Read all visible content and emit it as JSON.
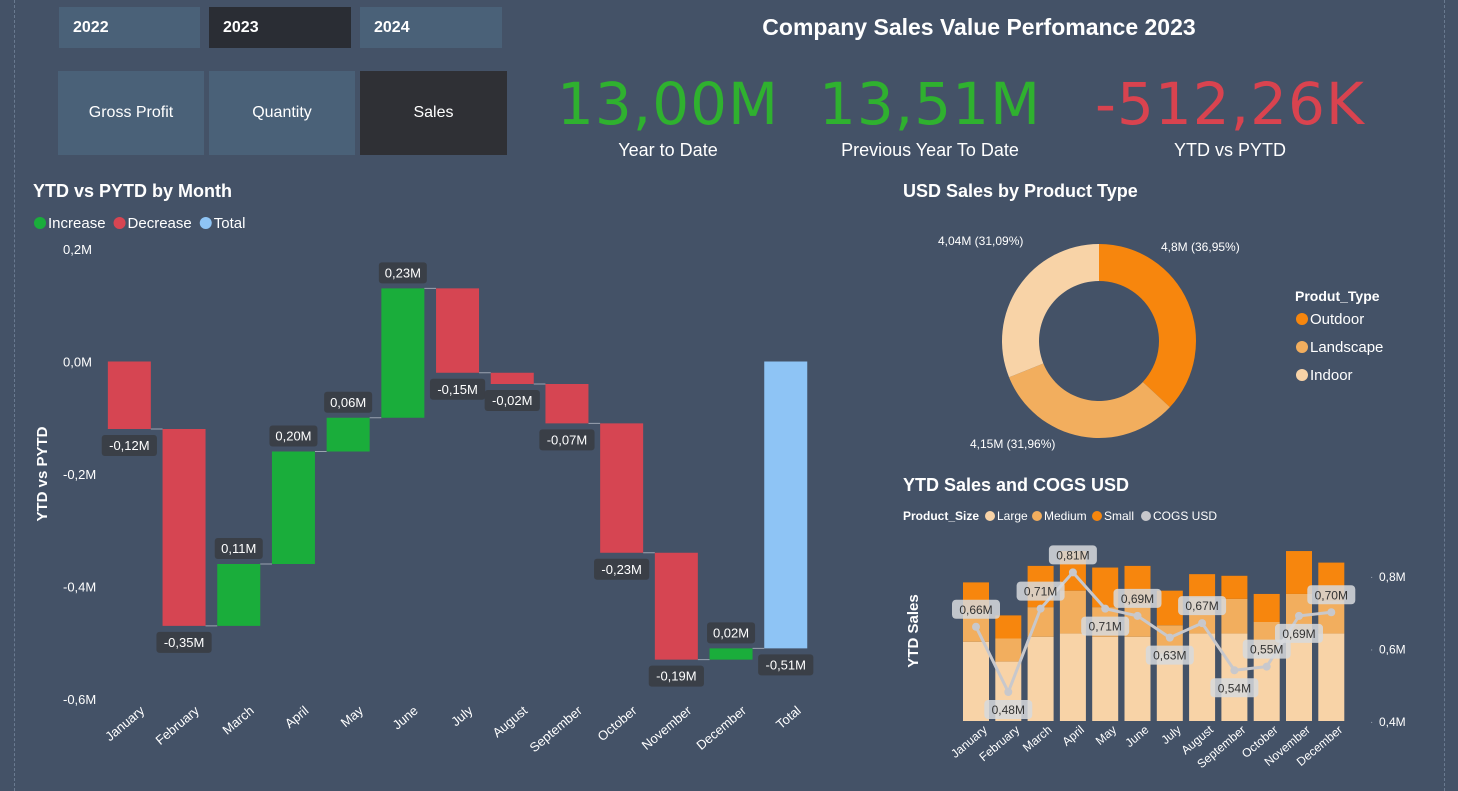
{
  "year_slicer": {
    "items": [
      "2022",
      "2023",
      "2024"
    ],
    "selected": 1
  },
  "measure_slicer": {
    "items": [
      "Gross Profit",
      "Quantity",
      "Sales"
    ],
    "selected": 2
  },
  "page_title": "Company Sales Value Perfomance 2023",
  "kpis": [
    {
      "value": "13,00M",
      "label": "Year to Date",
      "color": "#2fb12f"
    },
    {
      "value": "13,51M",
      "label": "Previous Year To Date",
      "color": "#2fb12f"
    },
    {
      "value": "-512,26K",
      "label": "YTD vs PYTD",
      "color": "#d9434f"
    }
  ],
  "colors": {
    "increase": "#1aad3b",
    "decrease": "#d64552",
    "total": "#8ec4f5",
    "outdoor": "#f7860d",
    "landscape": "#f2ae5e",
    "indoor": "#f8d3a7",
    "cogs": "#c8c8cc",
    "label_bg": "#3a3f47"
  },
  "chart_data": [
    {
      "type": "waterfall",
      "title": "YTD vs PYTD by Month",
      "legend": [
        "Increase",
        "Decrease",
        "Total"
      ],
      "legend_position": "top-left",
      "ylabel": "YTD vs PYTD",
      "ylim": [
        -0.6,
        0.2
      ],
      "yticks": [
        0.2,
        0.0,
        -0.2,
        -0.4,
        -0.6
      ],
      "ytick_labels": [
        "0,2M",
        "0,0M",
        "-0,2M",
        "-0,4M",
        "-0,6M"
      ],
      "categories": [
        "January",
        "February",
        "March",
        "April",
        "May",
        "June",
        "July",
        "August",
        "September",
        "October",
        "November",
        "December",
        "Total"
      ],
      "values": [
        -0.12,
        -0.35,
        0.11,
        0.2,
        0.06,
        0.23,
        -0.15,
        -0.02,
        -0.07,
        -0.23,
        -0.19,
        0.02,
        -0.51
      ],
      "labels": [
        "-0,12M",
        "-0,35M",
        "0,11M",
        "0,20M",
        "0,06M",
        "0,23M",
        "-0,15M",
        "-0,02M",
        "-0,07M",
        "-0,23M",
        "-0,19M",
        "0,02M",
        "-0,51M"
      ]
    },
    {
      "type": "pie",
      "donut": true,
      "title": "USD Sales by Product Type",
      "legend_title": "Produt_Type",
      "legend_position": "right",
      "slices": [
        {
          "name": "Outdoor",
          "value": 4.8,
          "percent": 36.95,
          "label": "4,8M (36,95%)"
        },
        {
          "name": "Landscape",
          "value": 4.15,
          "percent": 31.96,
          "label": "4,15M (31,96%)"
        },
        {
          "name": "Indoor",
          "value": 4.04,
          "percent": 31.09,
          "label": "4,04M (31,09%)"
        }
      ]
    },
    {
      "type": "bar",
      "stacked": true,
      "title": "YTD Sales and COGS USD",
      "legend_title": "Product_Size",
      "legend": [
        "Large",
        "Medium",
        "Small",
        "COGS USD"
      ],
      "legend_position": "top-left",
      "ylabel": "YTD Sales",
      "categories": [
        "January",
        "February",
        "March",
        "April",
        "May",
        "June",
        "July",
        "August",
        "September",
        "October",
        "November",
        "December"
      ],
      "series": [
        {
          "name": "Large",
          "values": [
            0.48,
            0.36,
            0.51,
            0.53,
            0.51,
            0.51,
            0.41,
            0.53,
            0.53,
            0.41,
            0.55,
            0.53
          ]
        },
        {
          "name": "Medium",
          "values": [
            0.18,
            0.14,
            0.18,
            0.26,
            0.18,
            0.2,
            0.17,
            0.22,
            0.21,
            0.19,
            0.22,
            0.2
          ]
        },
        {
          "name": "Small",
          "values": [
            0.18,
            0.14,
            0.25,
            0.24,
            0.24,
            0.23,
            0.21,
            0.14,
            0.14,
            0.17,
            0.26,
            0.23
          ]
        }
      ],
      "y2lim": [
        0.4,
        0.8
      ],
      "y2ticks": [
        "0,4M",
        "0,6M",
        "0,8M"
      ],
      "line": {
        "name": "COGS USD",
        "values": [
          0.66,
          0.48,
          0.71,
          0.81,
          0.71,
          0.69,
          0.63,
          0.67,
          0.54,
          0.55,
          0.69,
          0.7
        ],
        "labels": [
          "0,66M",
          "0,48M",
          "0,71M",
          "0,81M",
          "0,71M",
          "0,69M",
          "0,63M",
          "0,67M",
          "0,54M",
          "0,55M",
          "0,69M",
          "0,70M"
        ]
      }
    }
  ]
}
